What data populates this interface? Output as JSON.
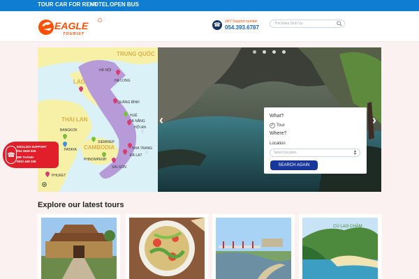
{
  "topnav": {
    "items": [
      "TOUR",
      "CAR FOR RENT",
      "HOTEL",
      "OPEN BUS"
    ]
  },
  "logo": {
    "brand": "EAGLE",
    "sub": "TOURIST"
  },
  "support": {
    "label": "24/7 Support number",
    "number": "054.393.6787"
  },
  "search": {
    "placeholder": "Tìm Kiếm Dịch Vụ"
  },
  "map": {
    "countries": [
      "TRUNG QUỐC",
      "LÀO",
      "THÁI LAN",
      "CAMBODIA"
    ],
    "places": [
      "HÀ NỘI",
      "HẠ LONG",
      "QUẢNG BÌNH",
      "HUẾ",
      "ĐÀ NẴNG",
      "HỘI AN",
      "BANGKOK",
      "SIEMRIEP",
      "PATAYA",
      "NHA TRANG",
      "ĐÀ LẠT",
      "PHNOMPENH",
      "SÀI GÒN",
      "PHUKET"
    ]
  },
  "slider": {
    "dots": 4,
    "active_dot": 0
  },
  "search_panel": {
    "what_label": "What?",
    "tour_option": "Tour",
    "where_label": "Where?",
    "location_label": "Location",
    "location_placeholder": "Select location",
    "button": "SEARCH AGAIN"
  },
  "float_support": {
    "english_label": "ENGLISH SUPPORT",
    "english_number": "054 3848 626",
    "contact_name": "MR THÀNH",
    "contact_number": "0932 449 335"
  },
  "latest": {
    "title": "Explore our latest tours",
    "photo_caption": "CÙ LAO CHÀM"
  },
  "colors": {
    "nav_blue": "#0f7dd1",
    "accent_orange": "#ff4e00",
    "button_navy": "#17379b",
    "support_red": "#e01f2b"
  }
}
